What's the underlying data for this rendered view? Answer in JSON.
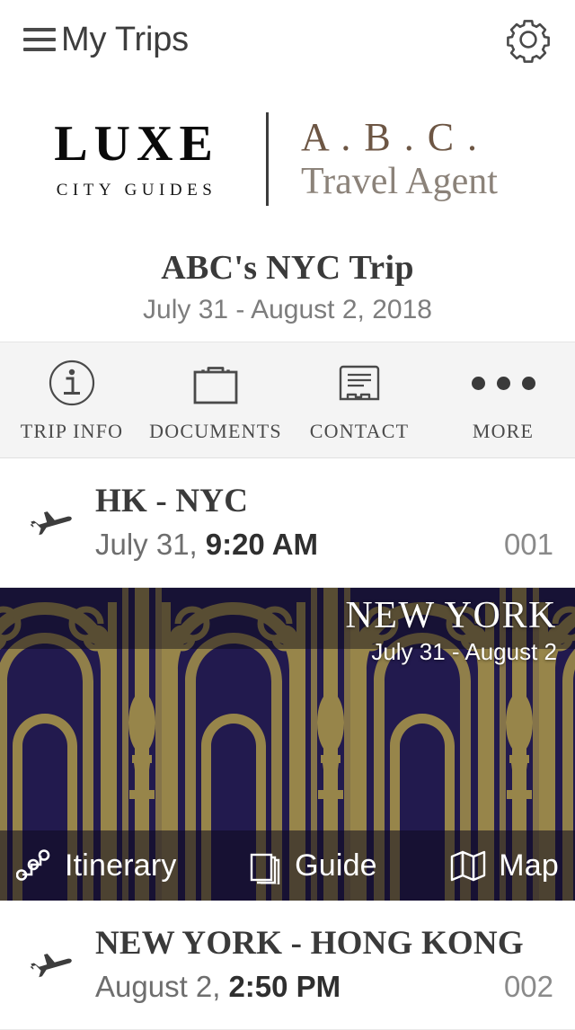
{
  "header": {
    "title": "My Trips",
    "menu_icon": "hamburger-menu-icon",
    "settings_icon": "gear-icon"
  },
  "branding": {
    "luxe_main": "LUXE",
    "luxe_sub": "CITY GUIDES",
    "agent_main": "A . B . C .",
    "agent_sub": "Travel Agent"
  },
  "trip": {
    "title": "ABC's NYC Trip",
    "dates": "July 31 - August 2, 2018"
  },
  "tabs": [
    {
      "label": "TRIP INFO",
      "icon": "info-circle-icon"
    },
    {
      "label": "DOCUMENTS",
      "icon": "briefcase-icon"
    },
    {
      "label": "CONTACT",
      "icon": "certificate-icon"
    },
    {
      "label": "MORE",
      "icon": "ellipsis-icon"
    }
  ],
  "flights": [
    {
      "route": "HK - NYC",
      "date": "July 31,",
      "time": "9:20 AM",
      "number": "001",
      "icon": "airplane-icon"
    },
    {
      "route": "NEW YORK - HONG KONG",
      "date": "August 2,",
      "time": "2:50 PM",
      "number": "002",
      "icon": "airplane-icon"
    }
  ],
  "destination": {
    "city": "NEW YORK",
    "dates": "July 31 - August 2",
    "actions": [
      {
        "label": "Itinerary",
        "icon": "route-nodes-icon"
      },
      {
        "label": "Guide",
        "icon": "book-stack-icon"
      },
      {
        "label": "Map",
        "icon": "folded-map-icon"
      }
    ],
    "art_colors": {
      "navy": "#221a4e",
      "gold": "#97854a"
    }
  }
}
